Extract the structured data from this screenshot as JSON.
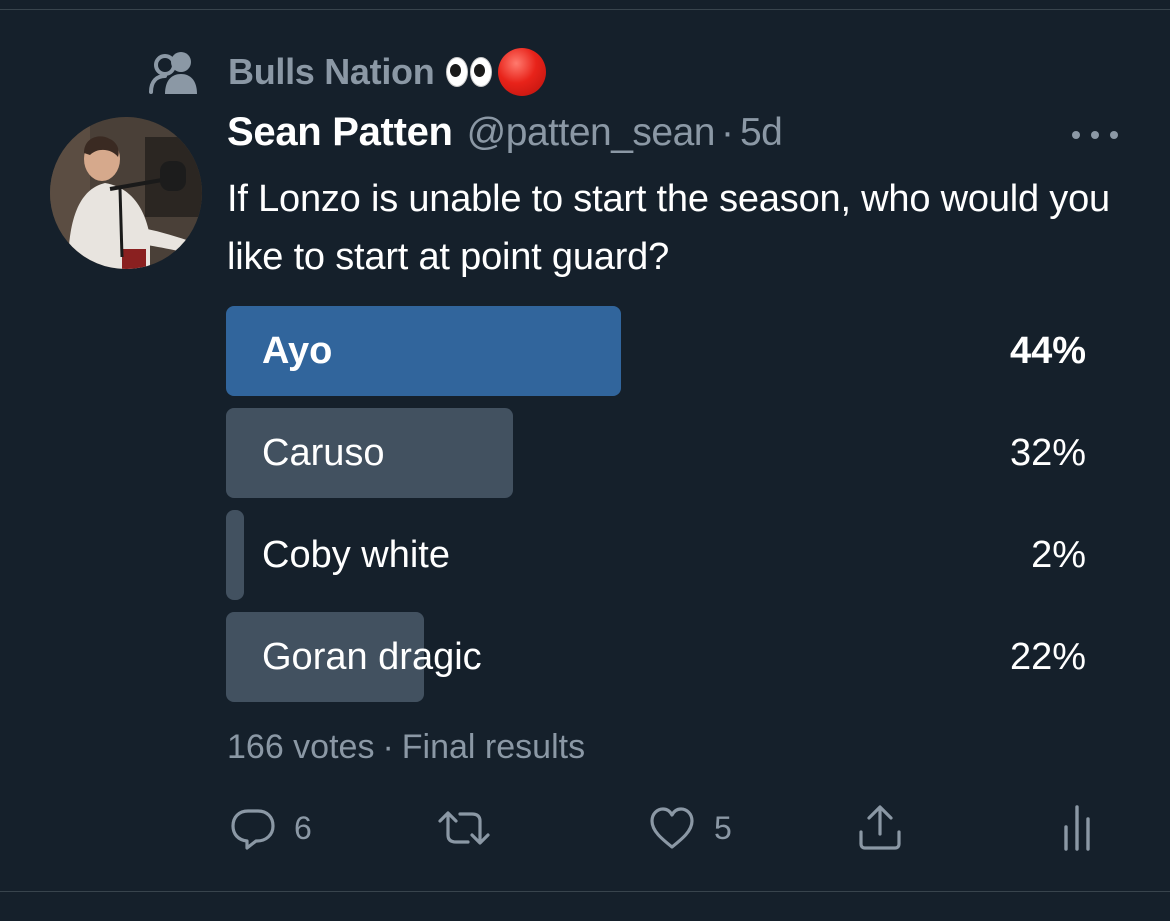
{
  "community": {
    "name": "Bulls Nation",
    "icon": "community-icon"
  },
  "tweet": {
    "author_name": "Sean Patten",
    "handle": "@patten_sean",
    "separator": "·",
    "time": "5d",
    "text": "If Lonzo is unable to start the season, who would you like to start at point guard?"
  },
  "poll": {
    "options": [
      {
        "label": "Ayo",
        "percent_text": "44%",
        "percent": 44,
        "winner": true
      },
      {
        "label": "Caruso",
        "percent_text": "32%",
        "percent": 32,
        "winner": false
      },
      {
        "label": "Coby white",
        "percent_text": "2%",
        "percent": 2,
        "winner": false
      },
      {
        "label": "Goran dragic",
        "percent_text": "22%",
        "percent": 22,
        "winner": false
      }
    ],
    "votes": "166 votes",
    "separator": "·",
    "status": "Final results"
  },
  "actions": {
    "reply_count": "6",
    "retweet_count": "",
    "like_count": "5"
  },
  "colors": {
    "background": "#15202b",
    "winner_bar": "#31659c",
    "other_bar": "#425160",
    "secondary_text": "#8b98a5"
  }
}
